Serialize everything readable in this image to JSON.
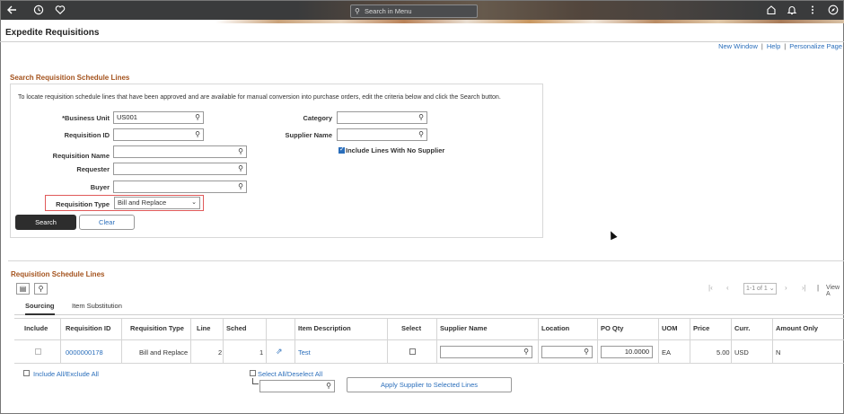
{
  "topbar": {
    "search_placeholder": "Search in Menu",
    "icons": [
      "back-arrow-icon",
      "history-icon",
      "favorites-heart-icon",
      "home-icon",
      "bell-icon",
      "more-vertical-icon",
      "compass-icon"
    ]
  },
  "page": {
    "title": "Expedite Requisitions",
    "links": {
      "new_window": "New Window",
      "help": "Help",
      "personalize": "Personalize Page"
    }
  },
  "search": {
    "section_title": "Search Requisition Schedule Lines",
    "instructions": "To locate requisition schedule lines that have been approved and are available for manual conversion into purchase orders, edit the criteria below and click the Search button.",
    "business_unit_label": "*Business Unit",
    "business_unit_value": "US001",
    "requisition_id_label": "Requisition ID",
    "requisition_name_label": "Requisition Name",
    "requester_label": "Requester",
    "buyer_label": "Buyer",
    "requisition_type_label": "Requisition Type",
    "requisition_type_value": "Bill and Replace",
    "category_label": "Category",
    "supplier_name_label": "Supplier Name",
    "include_no_supplier_label": "Include Lines With No Supplier",
    "include_no_supplier_checked": true,
    "search_button": "Search",
    "clear_button": "Clear"
  },
  "lines": {
    "section_title": "Requisition Schedule Lines",
    "pager": {
      "range": "1-1 of 1",
      "view_all": "View A"
    },
    "tabs": [
      "Sourcing",
      "Item Substitution"
    ],
    "columns": [
      "Include",
      "Requisition ID",
      "Requisition Type",
      "Line",
      "Sched",
      "",
      "Item Description",
      "Select",
      "Supplier Name",
      "Location",
      "PO Qty",
      "UOM",
      "Price",
      "Curr.",
      "Amount Only"
    ],
    "rows": [
      {
        "include": false,
        "requisition_id": "0000000178",
        "requisition_type": "Bill and Replace",
        "line": "2",
        "sched": "1",
        "item_description": "Test",
        "select": false,
        "supplier_name": "",
        "location": "",
        "po_qty": "10.0000",
        "uom": "EA",
        "price": "5.00",
        "curr": "USD",
        "amount_only": "N"
      }
    ],
    "include_all_label": "Include All/Exclude All",
    "select_all_label": "Select All/Deselect All",
    "apply_supplier_button": "Apply Supplier to Selected Lines"
  }
}
